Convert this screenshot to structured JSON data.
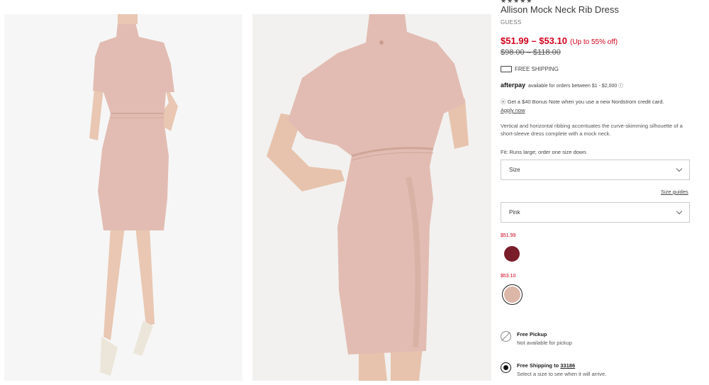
{
  "product": {
    "rating_stars": "★★★★★",
    "title": "Allison Mock Neck Rib Dress",
    "brand": "GUESS",
    "price_range": "$51.99 – $53.10",
    "discount": "(Up to 55% off)",
    "original_price": "$98.00 – $118.00",
    "shipping": "FREE SHIPPING",
    "afterpay_logo": "afterpay",
    "afterpay_text": "available for orders between $1 - $2,000",
    "bonus_note": "Get a $40 Bonus Note when you use a new Nordstrom credit card.",
    "apply_now": "Apply now",
    "description": "Vertical and horizontal ribbing accentuates the curve-skimming silhouette of a short-sleeve dress complete with a mock neck.",
    "fit_label": "Fit:",
    "fit_text": "Runs large; order one size down."
  },
  "selectors": {
    "size_value": "Size",
    "size_guides": "Size guides",
    "color_value": "Pink"
  },
  "swatches": [
    {
      "price": "$51.99",
      "color": "#7a1d2b"
    },
    {
      "price": "$53.10",
      "color": "#dcb7a8"
    }
  ],
  "fulfillment": {
    "pickup_title": "Free Pickup",
    "pickup_sub": "Not available for pickup",
    "shipping_title": "Free Shipping to",
    "shipping_zip": "33186",
    "shipping_sub": "Select a size to see when it will arrive."
  },
  "colors": {
    "sale_red": "#d0021b",
    "dress_pink": "#e2bcb2"
  }
}
